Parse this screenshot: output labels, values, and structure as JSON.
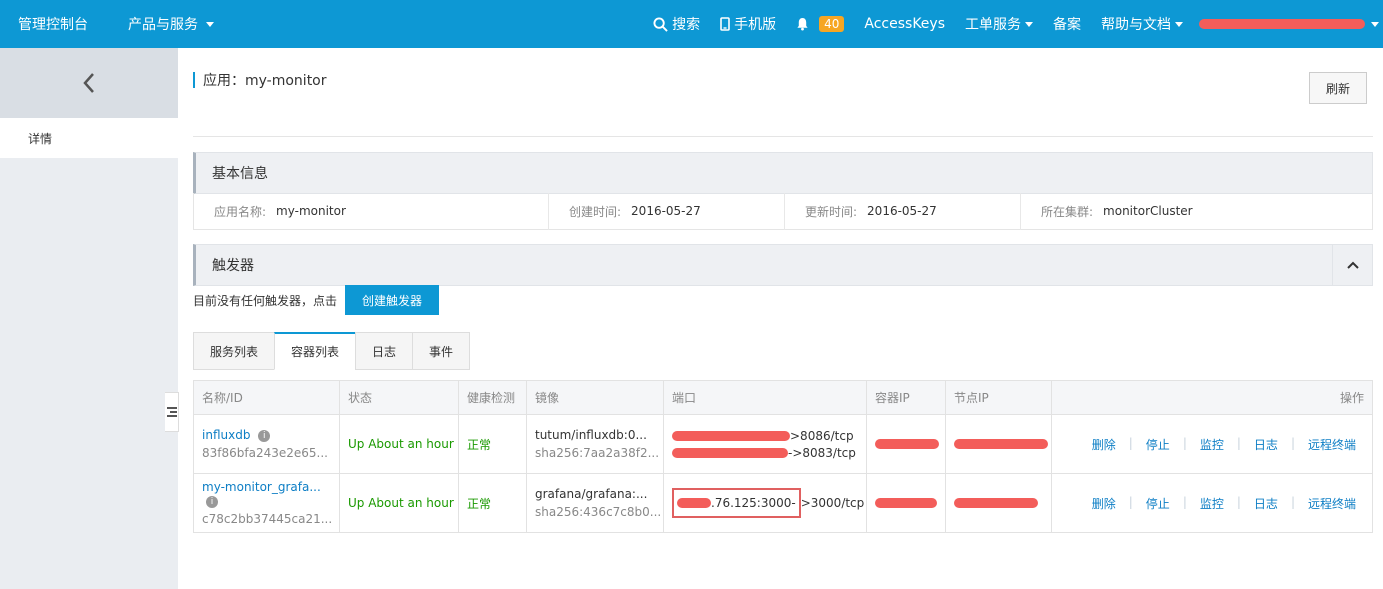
{
  "topbar": {
    "brand": "管理控制台",
    "products": "产品与服务",
    "search": "搜索",
    "mobile": "手机版",
    "notifications": "40",
    "accesskeys": "AccessKeys",
    "tickets": "工单服务",
    "beian": "备案",
    "help": "帮助与文档"
  },
  "sidebar": {
    "active_item": "详情"
  },
  "page": {
    "title": "应用：my-monitor",
    "refresh": "刷新"
  },
  "basic_info": {
    "heading": "基本信息",
    "fields": [
      {
        "label": "应用名称:",
        "value": "my-monitor"
      },
      {
        "label": "创建时间:",
        "value": "2016-05-27"
      },
      {
        "label": "更新时间:",
        "value": "2016-05-27"
      },
      {
        "label": "所在集群:",
        "value": "monitorCluster"
      }
    ]
  },
  "triggers": {
    "heading": "触发器",
    "empty_text": "目前没有任何触发器，点击",
    "create_button": "创建触发器"
  },
  "tabs": [
    "服务列表",
    "容器列表",
    "日志",
    "事件"
  ],
  "table": {
    "headers": [
      "名称/ID",
      "状态",
      "健康检测",
      "镜像",
      "端口",
      "容器IP",
      "节点IP",
      "操作"
    ],
    "rows": [
      {
        "name": "influxdb",
        "id": "83f86bfa243e2e65...",
        "status": "Up About an hour",
        "health": "正常",
        "image": "tutum/influxdb:0...",
        "digest": "sha256:7aa2a38f2...",
        "port1": ">8086/tcp",
        "port2": "->8083/tcp"
      },
      {
        "name": "my-monitor_grafa...",
        "id": "c78c2bb37445ca21...",
        "status": "Up About an hour",
        "health": "正常",
        "image": "grafana/grafana:...",
        "digest": "sha256:436c7c8b0...",
        "port1_ip": ".76.125:3000-",
        "port1": ">3000/tcp"
      }
    ],
    "ops": [
      "删除",
      "停止",
      "监控",
      "日志",
      "远程终端"
    ]
  },
  "colors": {
    "primary": "#0d98d4",
    "link": "#0d7ec5",
    "ok": "#1a9900",
    "redaction": "#f35d5a"
  }
}
